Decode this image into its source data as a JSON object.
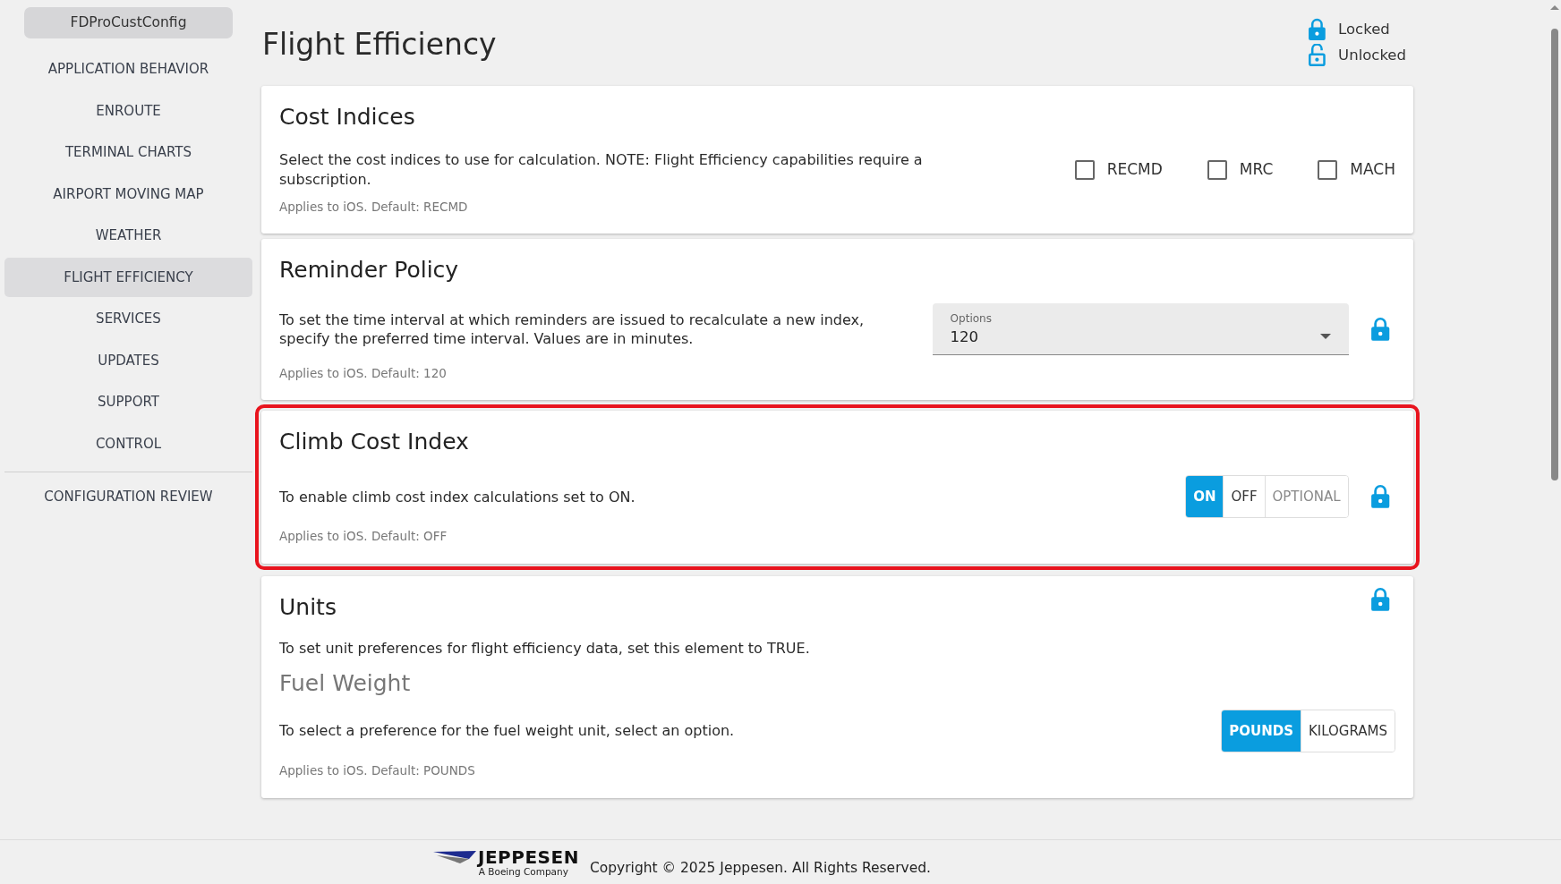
{
  "sidebar": {
    "header": "FDProCustConfig",
    "items": [
      {
        "label": "APPLICATION BEHAVIOR",
        "selected": false
      },
      {
        "label": "ENROUTE",
        "selected": false
      },
      {
        "label": "TERMINAL CHARTS",
        "selected": false
      },
      {
        "label": "AIRPORT MOVING MAP",
        "selected": false
      },
      {
        "label": "WEATHER",
        "selected": false
      },
      {
        "label": "FLIGHT EFFICIENCY",
        "selected": true
      },
      {
        "label": "SERVICES",
        "selected": false
      },
      {
        "label": "UPDATES",
        "selected": false
      },
      {
        "label": "SUPPORT",
        "selected": false
      },
      {
        "label": "CONTROL",
        "selected": false
      }
    ],
    "footer_item": {
      "label": "CONFIGURATION REVIEW",
      "selected": false
    }
  },
  "page_title": "Flight Efficiency",
  "legend": [
    {
      "label": "Locked",
      "locked": true
    },
    {
      "label": "Unlocked",
      "locked": false
    }
  ],
  "sections": [
    {
      "kind": "checkboxes",
      "title": "Cost Indices",
      "description": "Select the cost indices to use for calculation. NOTE: Flight Efficiency capabilities require a subscription.",
      "note": "Applies to iOS. Default: RECMD",
      "highlighted": false,
      "options": [
        {
          "label": "RECMD",
          "checked": false
        },
        {
          "label": "MRC",
          "checked": false
        },
        {
          "label": "MACH",
          "checked": false
        }
      ]
    },
    {
      "kind": "select",
      "title": "Reminder Policy",
      "description": "To set the time interval at which reminders are issued to recalculate a new index, specify the preferred time interval. Values are in minutes.",
      "note": "Applies to iOS. Default: 120",
      "highlighted": false,
      "locked": true,
      "select": {
        "label": "Options",
        "value": "120"
      }
    },
    {
      "kind": "toggle",
      "title": "Climb Cost Index",
      "description": "To enable climb cost index calculations set to ON.",
      "note": "Applies to iOS. Default: OFF",
      "highlighted": true,
      "locked": true,
      "options": [
        {
          "label": "ON",
          "selected": true,
          "disabled": false
        },
        {
          "label": "OFF",
          "selected": false,
          "disabled": false
        },
        {
          "label": "OPTIONAL",
          "selected": false,
          "disabled": true
        }
      ]
    },
    {
      "kind": "group",
      "title": "Units",
      "description": "To set unit preferences for flight efficiency data, set this element to TRUE.",
      "highlighted": false,
      "locked": true,
      "subsections": [
        {
          "title": "Fuel Weight",
          "description": "To select a preference for the fuel weight unit, select an option.",
          "note": "Applies to iOS. Default: POUNDS",
          "options": [
            {
              "label": "POUNDS",
              "selected": true,
              "disabled": false
            },
            {
              "label": "KILOGRAMS",
              "selected": false,
              "disabled": false
            }
          ]
        }
      ]
    }
  ],
  "footer": {
    "logo_name": "JEPPESEN",
    "logo_tagline": "A Boeing Company",
    "copyright": "Copyright © 2025 Jeppesen. All Rights Reserved."
  }
}
